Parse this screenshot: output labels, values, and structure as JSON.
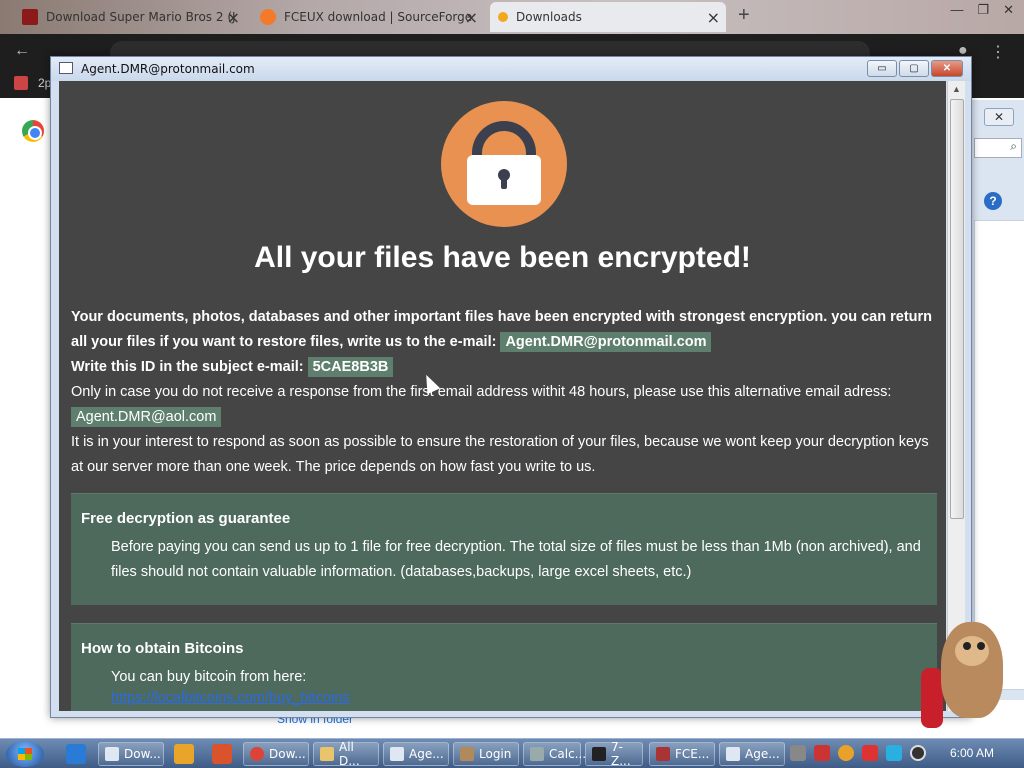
{
  "browser": {
    "tabs": [
      {
        "label": "Download Super Mario Bros 2 (J",
        "favicon": "roms-icon",
        "active": false
      },
      {
        "label": "FCEUX download | SourceForge",
        "favicon": "sourceforge-icon",
        "active": false
      },
      {
        "label": "Downloads",
        "favicon": "downloads-icon",
        "active": true
      }
    ],
    "new_tab": "+",
    "bookmark_label": "2p",
    "show_in_folder": "Show in folder"
  },
  "ransom_window": {
    "title": "Agent.DMR@protonmail.com",
    "controls": {
      "minimize": "▭",
      "maximize": "▢",
      "close": "✕"
    },
    "headline": "All your files have been encrypted!",
    "para1": "Your documents, photos, databases and other important files have been encrypted with strongest encryption. you can return all your files if you want to restore files, write us to the e-mail:",
    "email_primary": "Agent.DMR@protonmail.com",
    "id_label": "Write this ID in the subject e-mail:",
    "id_value": "5CAE8B3B",
    "para2": "Only in case you do not receive a response from the first email address withit 48 hours, please use this alternative email adress:",
    "email_alt": "Agent.DMR@aol.com",
    "para3": "It is in your interest to respond as soon as possible to ensure the restoration of your files, because we wont keep your decryption keys at our server more than one week. The price depends on how fast you write to us.",
    "panel1": {
      "title": "Free decryption as guarantee",
      "text": "Before paying you can send us up to 1 file for free decryption. The total size of files must be less than 1Mb (non archived), and files should not contain valuable information. (databases,backups, large excel sheets, etc.)"
    },
    "panel2": {
      "title": "How to obtain Bitcoins",
      "text": "You can buy bitcoin from here:",
      "link": "https://localbitcoins.com/buy_bitcoins"
    }
  },
  "taskbar": {
    "items": [
      {
        "label": "Dow...",
        "icon": "browser-icon"
      },
      {
        "label": "Dow...",
        "icon": "chrome-icon"
      },
      {
        "label": "All D...",
        "icon": "folder-icon"
      },
      {
        "label": "Age...",
        "icon": "window-icon"
      },
      {
        "label": "Login",
        "icon": "login-icon"
      },
      {
        "label": "Calc...",
        "icon": "calculator-icon"
      },
      {
        "label": "7-Z...",
        "icon": "7zip-icon"
      },
      {
        "label": "FCE...",
        "icon": "fceux-icon"
      },
      {
        "label": "Age...",
        "icon": "window-icon"
      }
    ],
    "clock": "6:00 AM"
  },
  "colors": {
    "content_bg": "#454545",
    "lock_orange": "#e89150",
    "highlight_green": "#5f7f6e",
    "panel_green": "#4d6a5c",
    "link_blue": "#2d6ae0"
  }
}
